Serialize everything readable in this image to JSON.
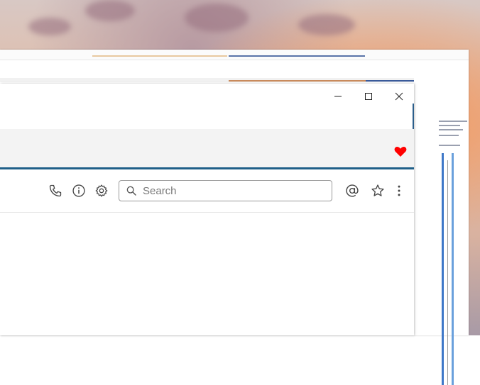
{
  "window": {
    "controls": {
      "minimize": "—",
      "maximize": "☐",
      "close": "✕"
    }
  },
  "header": {
    "favorite_icon": "heart-icon",
    "favorite_color": "#ff0000"
  },
  "toolbar": {
    "icons": [
      "phone-icon",
      "info-icon",
      "gear-icon",
      "at-icon",
      "star-icon",
      "more-vertical-icon"
    ],
    "accent_color": "#1f5f88"
  },
  "search": {
    "placeholder": "Search",
    "value": ""
  }
}
